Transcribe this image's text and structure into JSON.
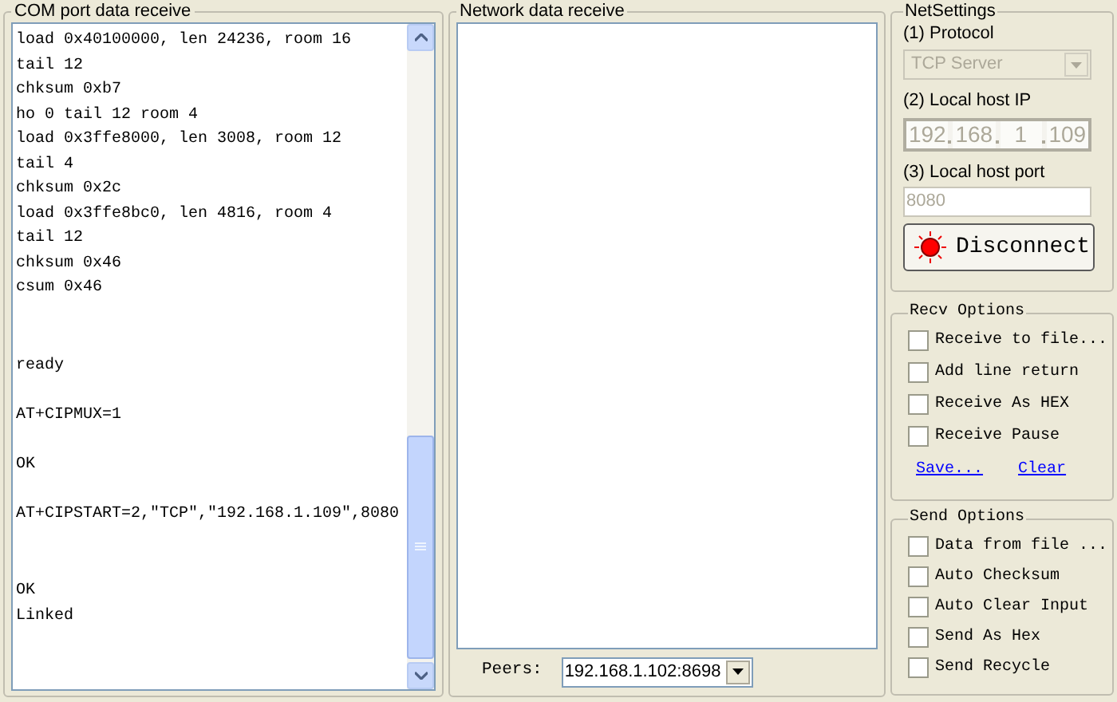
{
  "com_panel": {
    "title": "COM port data receive",
    "blocks": [
      {
        "kind": "first",
        "lines": [
          "load 0x40100000, len 24236, room 16",
          "tail 12",
          "chksum 0xb7",
          "ho 0 tail 12 room 4",
          "load 0x3ffe8000, len 3008, room 12",
          "tail 4",
          "chksum 0x2c",
          "load 0x3ffe8bc0, len 4816, room 4",
          "tail 12",
          "chksum 0x46",
          "csum 0x46"
        ]
      },
      {
        "kind": "after-wide-gap",
        "lines": [
          "ready"
        ]
      },
      {
        "kind": "after-gap",
        "lines": [
          "AT+CIPMUX=1"
        ]
      },
      {
        "kind": "after-gap",
        "lines": [
          "OK"
        ]
      },
      {
        "kind": "after-gap",
        "lines": [
          "AT+CIPSTART=2,\"TCP\",\"192.168.1.109\",8080"
        ]
      },
      {
        "kind": "after-wide-gap",
        "lines": [
          "OK",
          "Linked"
        ]
      }
    ]
  },
  "network_panel": {
    "title": "Network data receive",
    "peers_label": "Peers:",
    "peers_value": "192.168.1.102:8698"
  },
  "net_settings": {
    "title": "NetSettings",
    "protocol_label": "(1) Protocol",
    "protocol_value": "TCP Server",
    "ip_label": "(2) Local host IP",
    "ip_parts": [
      "192",
      "168",
      "1",
      "109"
    ],
    "port_label": "(3) Local host port",
    "port_value": "8080",
    "disabled": true,
    "connect_button": "Disconnect"
  },
  "recv_options": {
    "title": "Recv Options",
    "items": [
      {
        "label": "Receive to file...",
        "checked": false
      },
      {
        "label": "Add line return",
        "checked": false
      },
      {
        "label": "Receive As HEX",
        "checked": false
      },
      {
        "label": "Receive Pause",
        "checked": false
      }
    ],
    "links": [
      "Save...",
      "Clear"
    ]
  },
  "send_options": {
    "title": "Send Options",
    "items": [
      {
        "label": "Data from file ...",
        "checked": false
      },
      {
        "label": "Auto Checksum",
        "checked": false
      },
      {
        "label": "Auto Clear Input",
        "checked": false
      },
      {
        "label": "Send As Hex",
        "checked": false
      },
      {
        "label": "Send Recycle",
        "checked": false
      }
    ]
  }
}
